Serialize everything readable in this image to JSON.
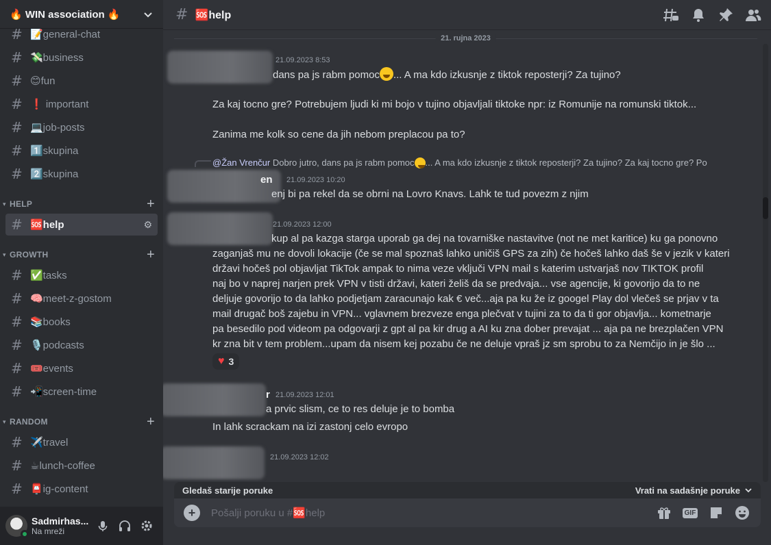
{
  "server": {
    "name": "🔥 WIN association 🔥"
  },
  "sidebar": {
    "channels_top": [
      {
        "label": "📝general-chat"
      },
      {
        "label": "💸business"
      },
      {
        "label": "😊fun"
      },
      {
        "label": "❗ important"
      },
      {
        "label": "💻job-posts"
      },
      {
        "label": "1️⃣skupina"
      },
      {
        "label": "2️⃣skupina"
      }
    ],
    "categories": [
      {
        "label": "HELP"
      },
      {
        "label": "GROWTH"
      },
      {
        "label": "RANDOM"
      }
    ],
    "help_channels": [
      {
        "label": "🆘help"
      }
    ],
    "growth_channels": [
      {
        "label": "✅tasks"
      },
      {
        "label": "🧠meet-z-gostom"
      },
      {
        "label": "📚books"
      },
      {
        "label": "🎙️podcasts"
      },
      {
        "label": "🎟️events"
      },
      {
        "label": "📲screen-time"
      }
    ],
    "random_channels": [
      {
        "label": "✈️travel"
      },
      {
        "label": "☕lunch-coffee"
      },
      {
        "label": "📮ig-content"
      }
    ]
  },
  "user": {
    "name": "Sadmirhas...",
    "status": "Na mreži",
    "status_color": "#23a55a"
  },
  "header": {
    "channel": "🆘help"
  },
  "messages": {
    "date_divider": "21. rujna 2023",
    "m1": {
      "time": "21.09.2023 8:53",
      "line1_prefix": "dans pa js rabm pomoc",
      "line1_suffix": "... A ma kdo izkusnje z tiktok reposterji? Za tujino?",
      "line2": "Za kaj tocno gre? Potrebujem ljudi ki mi bojo v tujino objavljali tiktoke npr: iz Romunije na romunski tiktok...",
      "line3": "Zanima me kolk so cene da jih nebom preplacou pa to?"
    },
    "reply": {
      "author": "@Žan Vrenčur",
      "text_prefix": " Dobro jutro, dans pa js rabm pomoc",
      "text_suffix": "... A ma kdo izkusnje z tiktok reposterji? Za tujino? Za kaj tocno gre? Po"
    },
    "m2": {
      "name_tail": "en",
      "time": "21.09.2023 10:20",
      "text": "enj bi pa rekel da se obrni na Lovro Knavs. Lahk te tud povezm z njim"
    },
    "m3": {
      "time": "21.09.2023 12:00",
      "lines": [
        "kup  al pa kazga starga uporab ga dej na tovarniške nastavitve (not ne met karitice) ku ga ponovno",
        "zaganjaš mu ne dovoli lokacije (če se mal spoznaš lahko uničiš GPS za zih) če hočeš lahko daš še v jezik v kateri",
        "državi hočeš pol objavljat TikTok ampak to nima veze vključi  VPN  mail s katerim ustvarjaš nov TIKTOK profil",
        "naj bo v naprej narjen prek VPN  v tisti državi, kateri želiš da se predvaja... vse agencije, ki govorijo da to ne",
        "deljuje govorijo to da lahko podjetjam zaracunajo kak € več...aja pa ku že iz googel Play dol vlečeš se prjav v ta",
        "mail drugač boš zajebu in VPN... vglavnem brezveze enga plečvat v tujini za to da ti gor objavlja... kometnarje",
        "pa besedilo pod videom pa odgovarji z gpt al pa kir drug a AI ku zna dober prevajat ... aja pa ne brezplačen VPN",
        "kr zna bit v tem problem...upam da nisem kej pozabu če ne deluje vpraš jz sm sprobu to za Nemčijo in je šlo ..."
      ],
      "reaction_count": "3"
    },
    "m4": {
      "name_tail": "r",
      "time": "21.09.2023 12:01",
      "line1": "a prvic slism, ce to res deluje je to bomba",
      "line2": "In lahk scrackam na izi zastonj celo evropo"
    },
    "m5": {
      "time": "21.09.2023 12:02"
    }
  },
  "banner": {
    "older": "Gledaš starije poruke",
    "jump": "Vrati na sadašnje poruke"
  },
  "composer": {
    "placeholder": "Pošalji poruku u #🆘help",
    "gif_label": "GIF"
  }
}
